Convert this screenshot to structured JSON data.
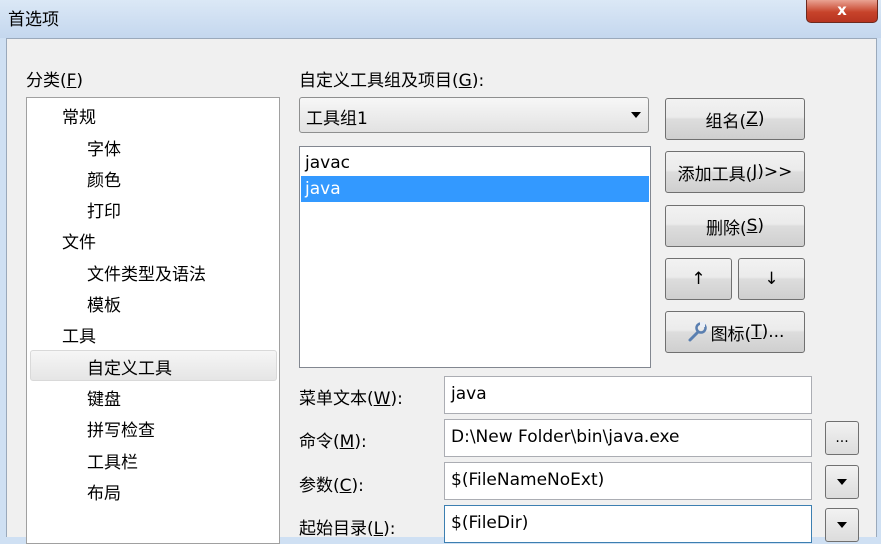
{
  "window": {
    "title": "首选项",
    "close_glyph": "x"
  },
  "category": {
    "label": "分类(",
    "mnemonic": "F",
    "label_end": ")",
    "items": [
      {
        "label": "常规"
      },
      {
        "label": "字体"
      },
      {
        "label": "颜色"
      },
      {
        "label": "打印"
      },
      {
        "label": "文件"
      },
      {
        "label": "文件类型及语法"
      },
      {
        "label": "模板"
      },
      {
        "label": "工具"
      },
      {
        "label": "自定义工具",
        "selected": true
      },
      {
        "label": "键盘"
      },
      {
        "label": "拼写检查"
      },
      {
        "label": "工具栏"
      },
      {
        "label": "布局"
      }
    ]
  },
  "toolgroup": {
    "label": "自定义工具组及项目(",
    "mnemonic": "G",
    "label_end": "):",
    "selected": "工具组1",
    "items": [
      {
        "label": "javac"
      },
      {
        "label": "java",
        "selected": true
      }
    ]
  },
  "buttons": {
    "group_name": {
      "pre": "组名(",
      "mn": "Z",
      "post": ")"
    },
    "add_tool": {
      "pre": "添加工具(",
      "mn": "J",
      "post": ")>>"
    },
    "delete": {
      "pre": "删除(",
      "mn": "S",
      "post": ")"
    },
    "move_up": "↑",
    "move_down": "↓",
    "icon": {
      "pre": "图标(",
      "mn": "T",
      "post": ")..."
    },
    "browse": "..."
  },
  "fields": {
    "menu_text": {
      "pre": "菜单文本(",
      "mn": "W",
      "post": "):",
      "value": "java"
    },
    "command": {
      "pre": "命令(",
      "mn": "M",
      "post": "):",
      "value": "D:\\New Folder\\bin\\java.exe"
    },
    "params": {
      "pre": "参数(",
      "mn": "C",
      "post": "):",
      "value": "$(FileNameNoExt)"
    },
    "start_dir": {
      "pre": "起始目录(",
      "mn": "L",
      "post": "):",
      "value": "$(FileDir)"
    }
  },
  "colors": {
    "selection": "#3399ff",
    "close_button": "#c7432b"
  }
}
